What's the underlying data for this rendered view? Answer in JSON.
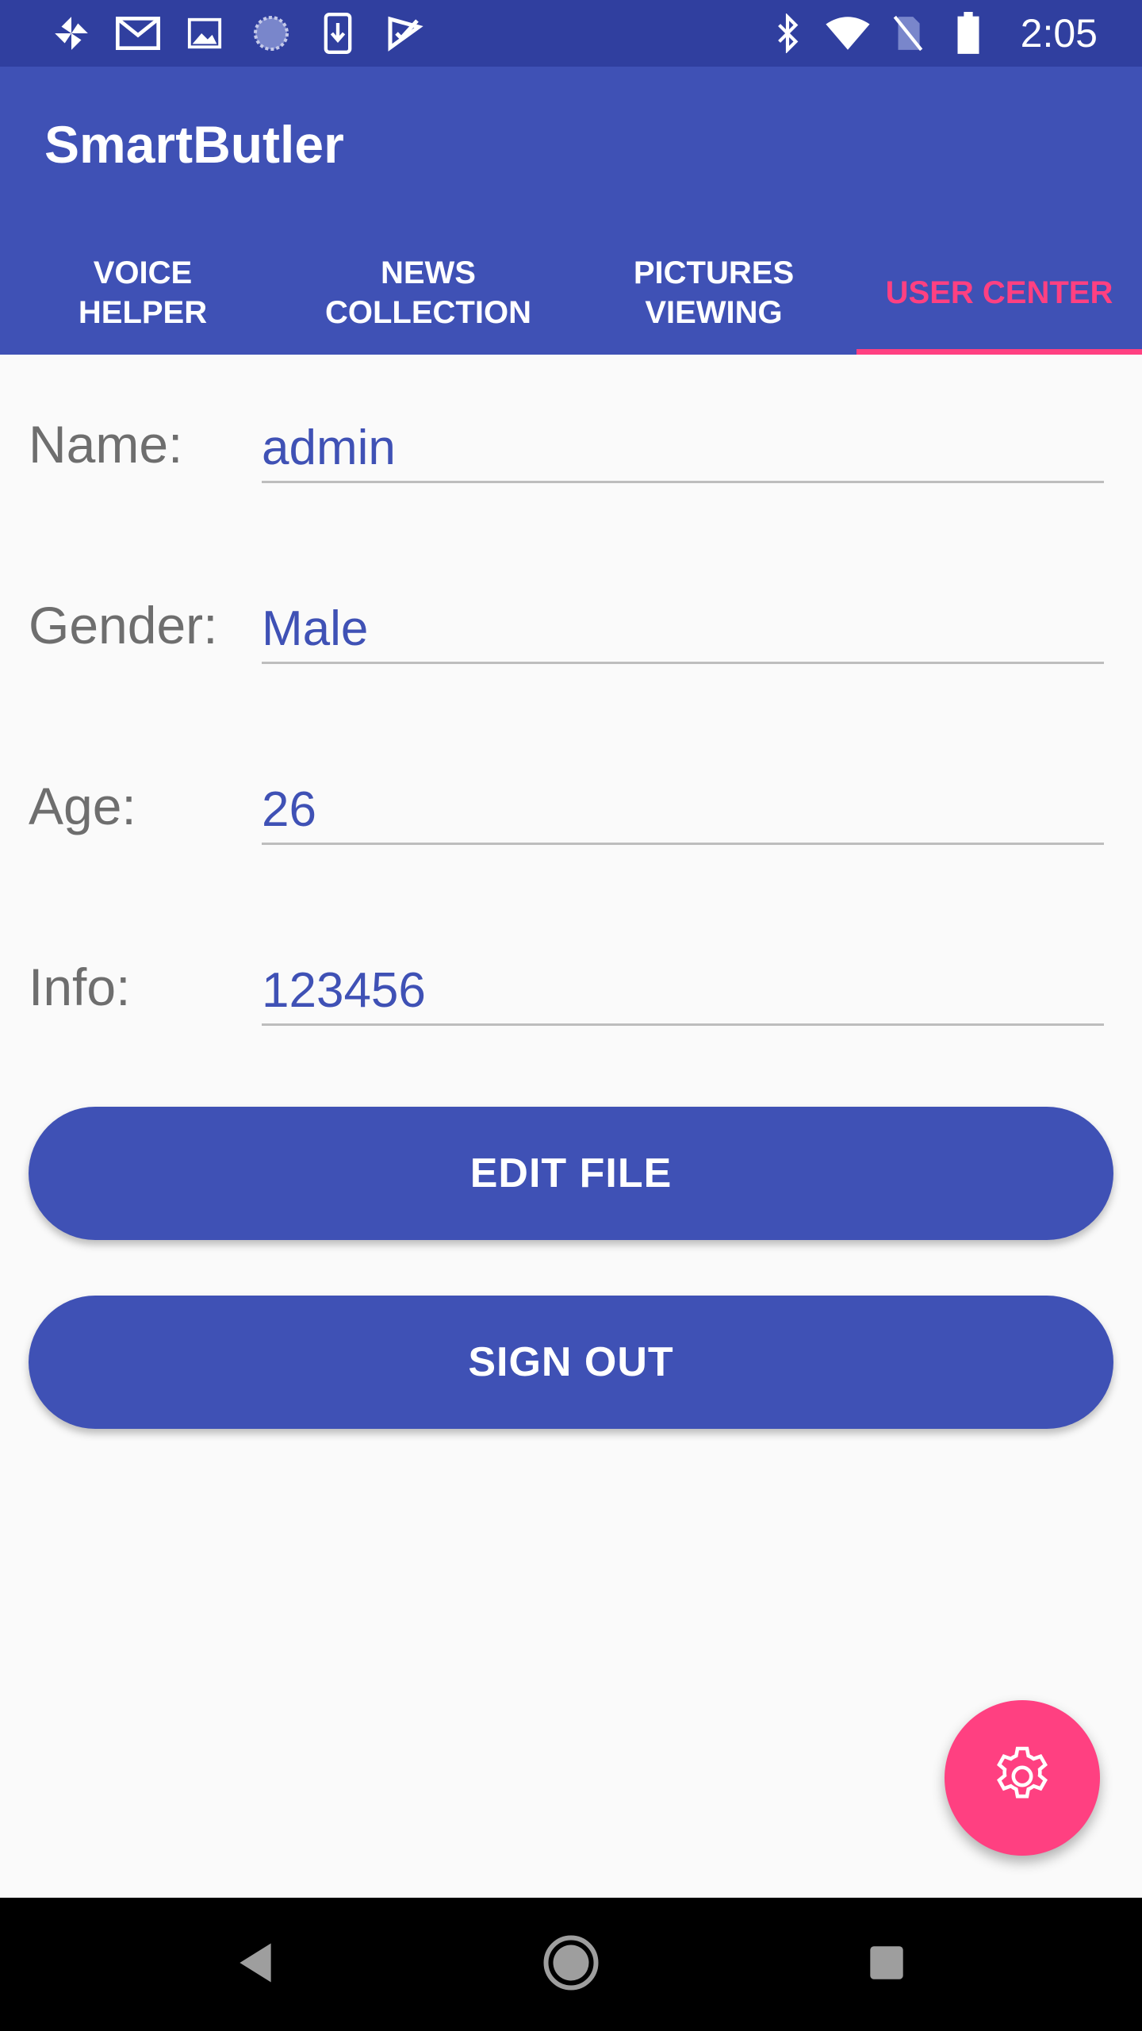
{
  "status_bar": {
    "time": "2:05",
    "left_icons": [
      "pinwheel-icon",
      "gmail-icon",
      "image-icon",
      "sync-icon",
      "download-icon",
      "checkmark-app-icon"
    ],
    "right_icons": [
      "bluetooth-icon",
      "wifi-icon",
      "no-sim-icon",
      "battery-icon"
    ]
  },
  "app_bar": {
    "title": "SmartButler",
    "tabs": [
      {
        "line1": "VOICE",
        "line2": "HELPER",
        "active": false
      },
      {
        "line1": "NEWS",
        "line2": "COLLECTION",
        "active": false
      },
      {
        "line1": "PICTURES",
        "line2": "VIEWING",
        "active": false
      },
      {
        "line1": "USER CENTER",
        "line2": "",
        "active": true
      }
    ]
  },
  "form": {
    "name_label": "Name:",
    "name_value": "admin",
    "gender_label": "Gender:",
    "gender_value": "Male",
    "age_label": "Age:",
    "age_value": "26",
    "info_label": "Info:",
    "info_value": "123456"
  },
  "buttons": {
    "edit_file": "EDIT FILE",
    "sign_out": "SIGN OUT"
  },
  "fab": {
    "icon": "gear-icon"
  },
  "nav_bar": {
    "icons": [
      "back-icon",
      "home-icon",
      "recents-icon"
    ]
  },
  "colors": {
    "primary": "#3f51b5",
    "primary_dark": "#303f9f",
    "accent": "#ff4081",
    "background": "#fafafa"
  }
}
